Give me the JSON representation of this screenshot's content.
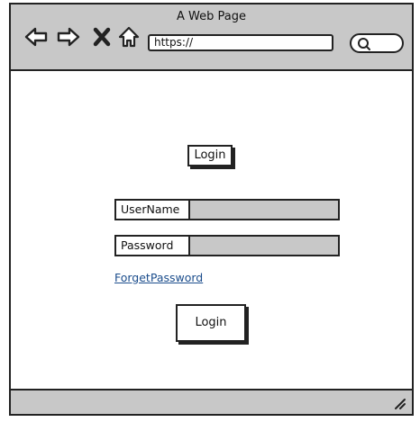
{
  "browser": {
    "title": "A Web Page",
    "url": "https://",
    "search_query": "",
    "icons": [
      "back-arrow-icon",
      "forward-arrow-icon",
      "close-icon",
      "home-icon",
      "search-icon",
      "resize-handle-icon"
    ]
  },
  "page": {
    "top_button_label": "Login",
    "form": {
      "username_label": "UserName",
      "username_value": "",
      "password_label": "Password",
      "password_value": ""
    },
    "forgot_link": "ForgetPassword",
    "submit_label": "Login"
  },
  "colors": {
    "chrome_gray": "#c8c8c8",
    "input_gray": "#c8c8c8",
    "link_blue": "#1b4d8c",
    "outline": "#222222"
  }
}
